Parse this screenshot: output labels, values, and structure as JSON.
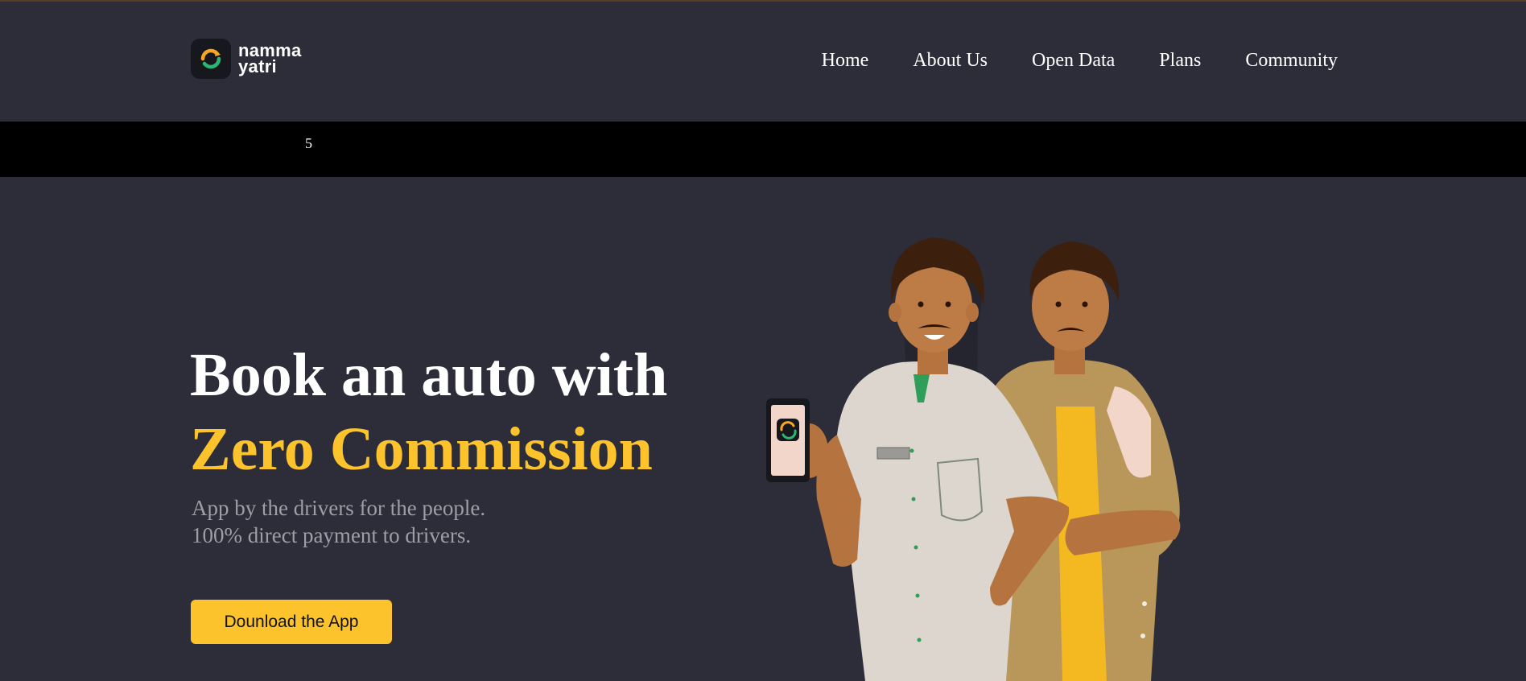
{
  "brand": {
    "name_line1": "namma",
    "name_line2": "yatri",
    "logo_icon": "namma-yatri-logo-icon",
    "colors": {
      "accent": "#fcc32c",
      "logo_orange": "#f5a623",
      "logo_green": "#2bb673",
      "background": "#2c2d39"
    }
  },
  "nav": {
    "items": [
      {
        "label": "Home"
      },
      {
        "label": "About Us"
      },
      {
        "label": "Open Data"
      },
      {
        "label": "Plans"
      },
      {
        "label": "Community"
      }
    ]
  },
  "ticker": {
    "text": "5"
  },
  "hero": {
    "title_line1": "Book an auto with",
    "title_line2": "Zero Commission",
    "subtitle_line1": "App by the drivers for the people.",
    "subtitle_line2": "100% direct payment to drivers.",
    "cta_label": "Dounload the App"
  }
}
